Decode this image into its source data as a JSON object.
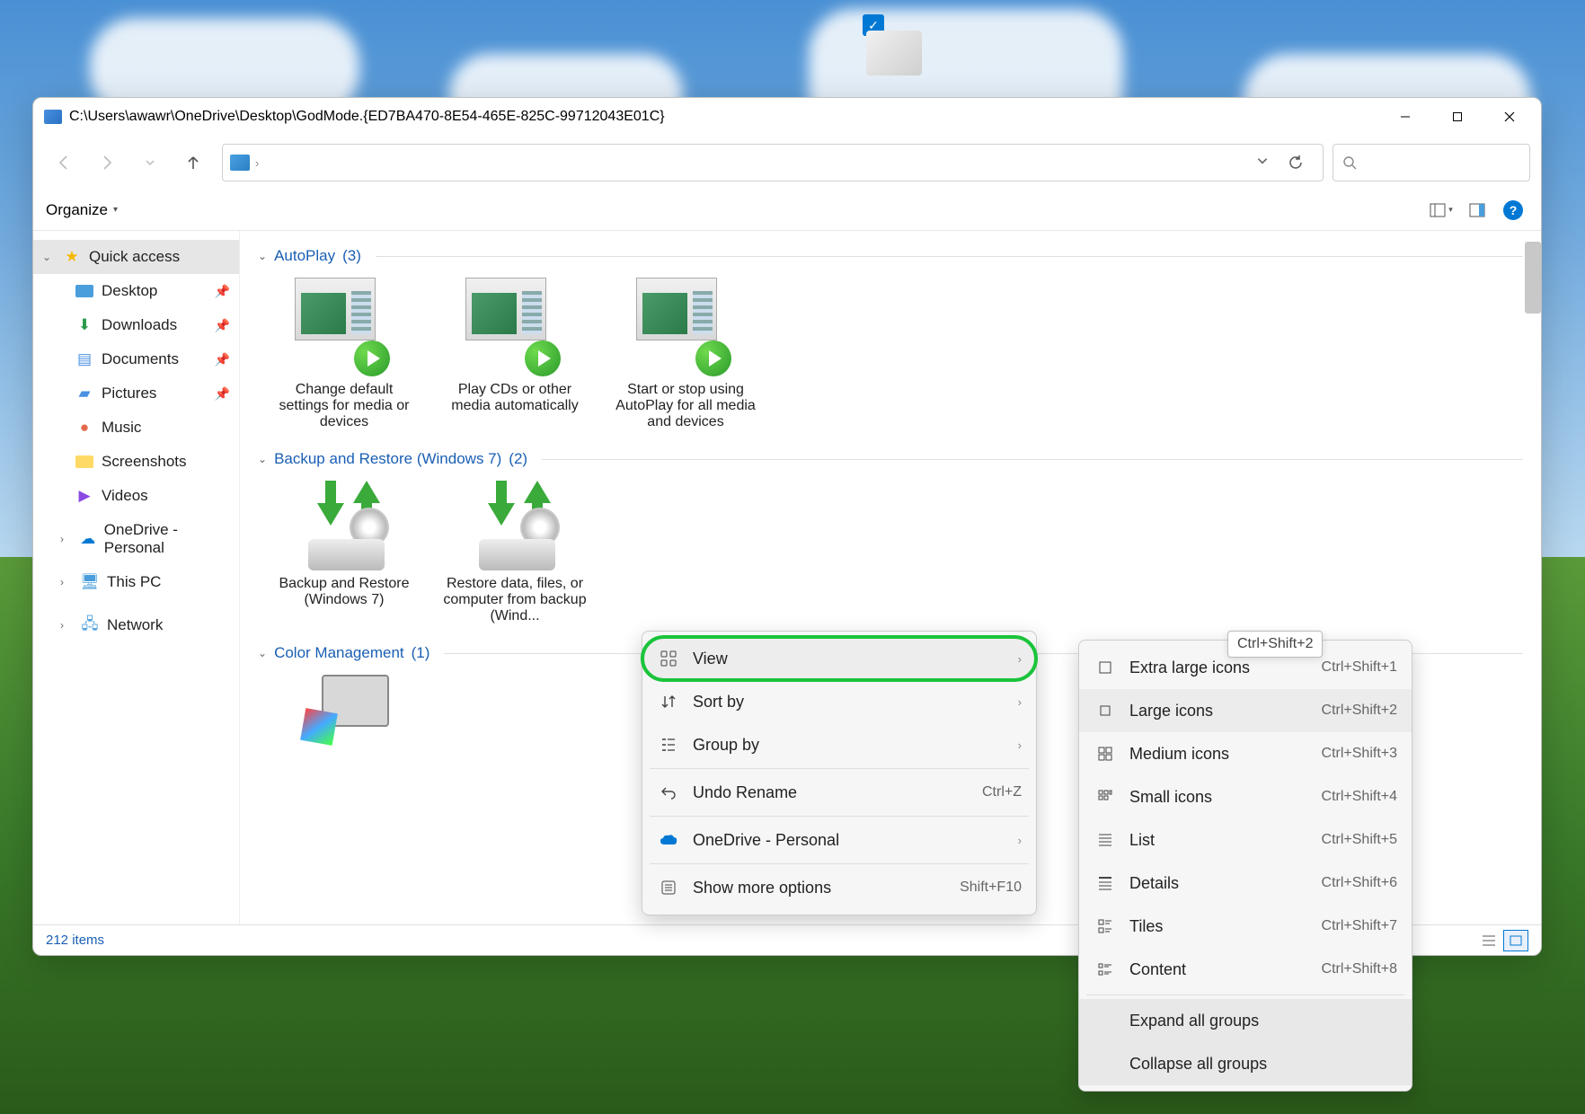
{
  "window": {
    "title": "C:\\Users\\awawr\\OneDrive\\Desktop\\GodMode.{ED7BA470-8E54-465E-825C-99712043E01C}"
  },
  "toolbar": {
    "organize_label": "Organize"
  },
  "sidebar": {
    "quick_access": "Quick access",
    "items": [
      {
        "label": "Desktop"
      },
      {
        "label": "Downloads"
      },
      {
        "label": "Documents"
      },
      {
        "label": "Pictures"
      },
      {
        "label": "Music"
      },
      {
        "label": "Screenshots"
      },
      {
        "label": "Videos"
      }
    ],
    "onedrive": "OneDrive - Personal",
    "thispc": "This PC",
    "network": "Network"
  },
  "groups": [
    {
      "title": "AutoPlay",
      "count": "(3)",
      "items": [
        {
          "label": "Change default settings for media or devices"
        },
        {
          "label": "Play CDs or other media automatically"
        },
        {
          "label": "Start or stop using AutoPlay for all media and devices"
        }
      ]
    },
    {
      "title": "Backup and Restore (Windows 7)",
      "count": "(2)",
      "items": [
        {
          "label": "Backup and Restore (Windows 7)"
        },
        {
          "label": "Restore data, files, or computer from backup (Wind..."
        }
      ]
    },
    {
      "title": "Color Management",
      "count": "(1)",
      "items": [
        {
          "label": ""
        }
      ]
    }
  ],
  "status": {
    "items": "212 items"
  },
  "contextmenu": {
    "view": "View",
    "sortby": "Sort by",
    "groupby": "Group by",
    "undo": "Undo Rename",
    "undo_shortcut": "Ctrl+Z",
    "onedrive": "OneDrive - Personal",
    "showmore": "Show more options",
    "showmore_shortcut": "Shift+F10"
  },
  "submenu": {
    "items": [
      {
        "label": "Extra large icons",
        "shortcut": "Ctrl+Shift+1"
      },
      {
        "label": "Large icons",
        "shortcut": "Ctrl+Shift+2"
      },
      {
        "label": "Medium icons",
        "shortcut": "Ctrl+Shift+3"
      },
      {
        "label": "Small icons",
        "shortcut": "Ctrl+Shift+4"
      },
      {
        "label": "List",
        "shortcut": "Ctrl+Shift+5"
      },
      {
        "label": "Details",
        "shortcut": "Ctrl+Shift+6"
      },
      {
        "label": "Tiles",
        "shortcut": "Ctrl+Shift+7"
      },
      {
        "label": "Content",
        "shortcut": "Ctrl+Shift+8"
      }
    ],
    "expand": "Expand all groups",
    "collapse": "Collapse all groups"
  },
  "tooltip": "Ctrl+Shift+2"
}
